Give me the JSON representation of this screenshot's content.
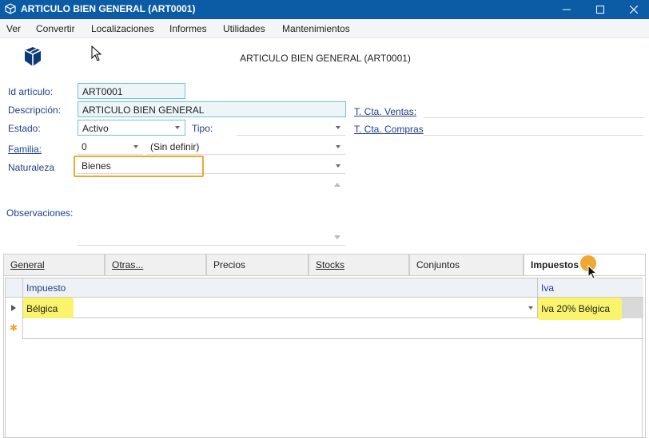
{
  "window": {
    "title": "ARTICULO BIEN GENERAL (ART0001)",
    "icon": "cube-icon",
    "buttons": [
      "minimize",
      "maximize",
      "close"
    ]
  },
  "menu": {
    "items": [
      "Ver",
      "Convertir",
      "Localizaciones",
      "Informes",
      "Utilidades",
      "Mantenimientos"
    ]
  },
  "header": {
    "title": "ARTICULO BIEN GENERAL (ART0001)"
  },
  "form": {
    "id_label": "Id artículo:",
    "id_value": "ART0001",
    "desc_label": "Descripción:",
    "desc_value": "ARTICULO BIEN GENERAL",
    "estado_label": "Estado:",
    "estado_value": "Activo",
    "tipo_label": "Tipo:",
    "tipo_value": "",
    "familia_label": "Familia:",
    "familia_code": "0",
    "familia_value": "(Sin definir)",
    "naturaleza_label": "Naturaleza",
    "naturaleza_value": "Bienes",
    "observaciones_label": "Observaciones:",
    "cta_ventas_label": "T. Cta. Ventas:",
    "cta_compras_label": "T. Cta. Compras"
  },
  "tabs": [
    {
      "label": "General",
      "active": false
    },
    {
      "label": "Otras...",
      "active": false
    },
    {
      "label": "Precios",
      "active": false
    },
    {
      "label": "Stocks",
      "active": false
    },
    {
      "label": "Conjuntos",
      "active": false
    },
    {
      "label": "Impuestos",
      "active": true
    }
  ],
  "grid": {
    "columns": [
      "Impuesto",
      "Iva"
    ],
    "rows": [
      {
        "impuesto": "Bélgica",
        "iva": "Iva 20% Bélgica"
      }
    ],
    "new_row_marker": "✱"
  },
  "colors": {
    "titlebar": "#0b5ba5",
    "label_blue": "#1d3f8a",
    "highlight_orange": "#f0a830",
    "highlight_yellow": "#faf36c",
    "field_border": "#6fc4d8"
  }
}
